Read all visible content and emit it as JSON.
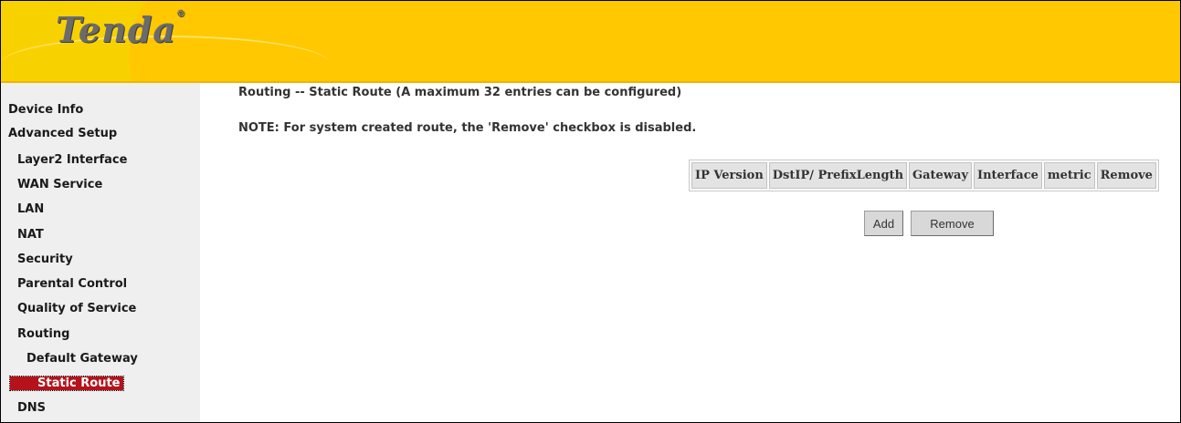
{
  "brand": {
    "logo_text": "Tenda",
    "logo_mark": "®"
  },
  "sidebar": {
    "items": [
      {
        "label": "Device Info",
        "level": 0,
        "active": false
      },
      {
        "label": "Advanced Setup",
        "level": 0,
        "active": false
      },
      {
        "label": "Layer2 Interface",
        "level": 1,
        "active": false
      },
      {
        "label": "WAN Service",
        "level": 1,
        "active": false
      },
      {
        "label": "LAN",
        "level": 1,
        "active": false
      },
      {
        "label": "NAT",
        "level": 1,
        "active": false
      },
      {
        "label": "Security",
        "level": 1,
        "active": false
      },
      {
        "label": "Parental Control",
        "level": 1,
        "active": false
      },
      {
        "label": "Quality of Service",
        "level": 1,
        "active": false
      },
      {
        "label": "Routing",
        "level": 1,
        "active": false
      },
      {
        "label": "Default Gateway",
        "level": 2,
        "active": false
      },
      {
        "label": "Static Route",
        "level": 2,
        "active": true
      },
      {
        "label": "DNS",
        "level": 1,
        "active": false
      }
    ]
  },
  "main": {
    "title": "Routing -- Static Route (A maximum 32 entries can be configured)",
    "note": "NOTE: For system created route, the 'Remove' checkbox is disabled.",
    "table": {
      "columns": [
        "IP Version",
        "DstIP/ PrefixLength",
        "Gateway",
        "Interface",
        "metric",
        "Remove"
      ],
      "rows": []
    },
    "buttons": {
      "add": "Add",
      "remove": "Remove"
    }
  },
  "colors": {
    "header": "#ffc800",
    "active_item": "#b5121b",
    "sidebar_bg": "#efefef"
  }
}
